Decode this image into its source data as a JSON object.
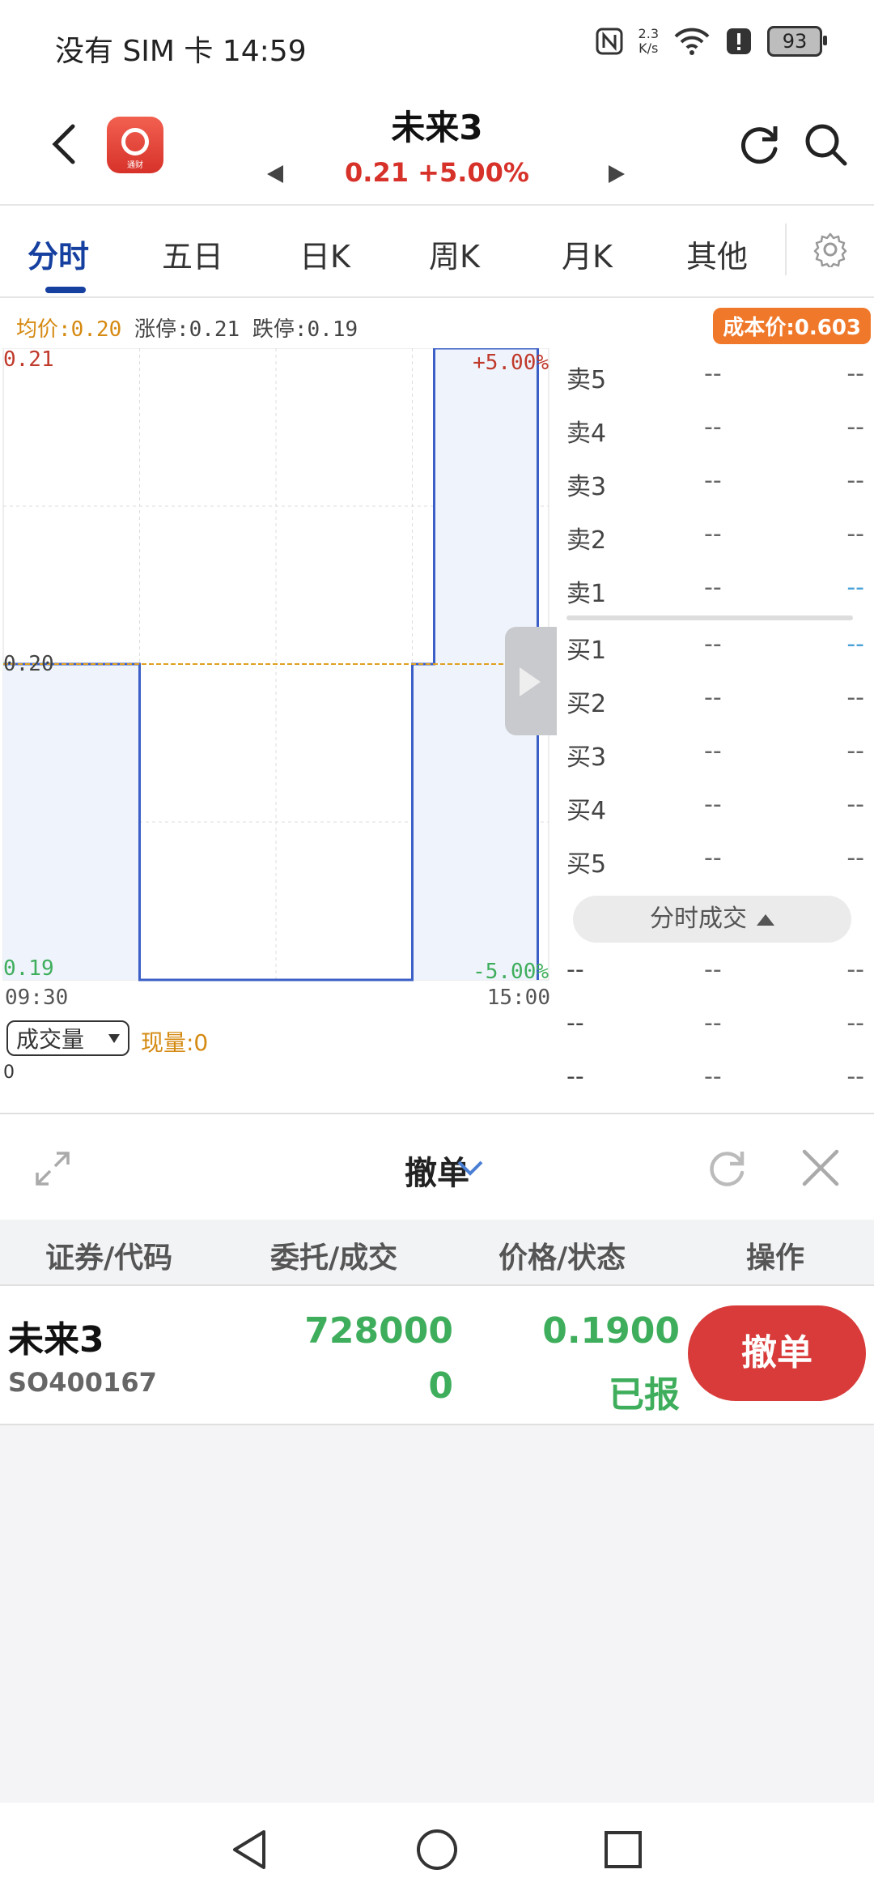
{
  "status_bar": {
    "left_text": "没有 SIM 卡 14:59",
    "speed_top": "2.3",
    "speed_bottom": "K/s",
    "battery": "93"
  },
  "header": {
    "logo_text": "通财",
    "title": "未来3",
    "price": "0.21",
    "change": "+5.00%"
  },
  "tabs": [
    {
      "label": "分时",
      "active": true
    },
    {
      "label": "五日"
    },
    {
      "label": "日K"
    },
    {
      "label": "周K"
    },
    {
      "label": "月K"
    },
    {
      "label": "其他"
    }
  ],
  "stats": {
    "avg": "均价:0.20",
    "limit_up": "涨停:0.21",
    "limit_down": "跌停:0.19",
    "cost_price": "成本价:0.603"
  },
  "chart_data": {
    "type": "line",
    "x": [
      "09:30",
      "15:00"
    ],
    "y_labels": {
      "top": "0.21",
      "mid": "0.20",
      "bottom": "0.19"
    },
    "pct_labels": {
      "top": "+5.00%",
      "bottom": "-5.00%"
    },
    "ylim": [
      0.19,
      0.21
    ],
    "time_fraction": [
      0,
      0.25,
      0.25,
      0.75,
      0.75,
      0.79,
      0.79,
      0.98,
      0.98
    ],
    "price": [
      0.2,
      0.2,
      0.19,
      0.19,
      0.2,
      0.2,
      0.21,
      0.21,
      0.19
    ],
    "avg_price": 0.2,
    "colors": {
      "line": "#3b5fc6",
      "fill": "#eef3fc",
      "avg": "#e0a020"
    },
    "grid": true
  },
  "orderbook": {
    "sell": [
      {
        "label": "卖5",
        "price": "--",
        "vol": "--"
      },
      {
        "label": "卖4",
        "price": "--",
        "vol": "--"
      },
      {
        "label": "卖3",
        "price": "--",
        "vol": "--"
      },
      {
        "label": "卖2",
        "price": "--",
        "vol": "--"
      },
      {
        "label": "卖1",
        "price": "--",
        "vol": "--"
      }
    ],
    "buy": [
      {
        "label": "买1",
        "price": "--",
        "vol": "--"
      },
      {
        "label": "买2",
        "price": "--",
        "vol": "--"
      },
      {
        "label": "买3",
        "price": "--",
        "vol": "--"
      },
      {
        "label": "买4",
        "price": "--",
        "vol": "--"
      },
      {
        "label": "买5",
        "price": "--",
        "vol": "--"
      }
    ],
    "trade_button": "分时成交",
    "trades": [
      {
        "a": "--",
        "b": "--",
        "c": "--"
      },
      {
        "a": "--",
        "b": "--",
        "c": "--"
      },
      {
        "a": "--",
        "b": "--",
        "c": "--"
      }
    ]
  },
  "volume": {
    "select": "成交量",
    "current": "现量:0",
    "zero": "0"
  },
  "panel": {
    "title": "撤单",
    "columns": [
      "证券/代码",
      "委托/成交",
      "价格/状态",
      "操作"
    ],
    "order": {
      "name": "未来3",
      "code": "SO400167",
      "entrust": "728000",
      "filled": "0",
      "price": "0.1900",
      "status": "已报",
      "action": "撤单"
    }
  }
}
